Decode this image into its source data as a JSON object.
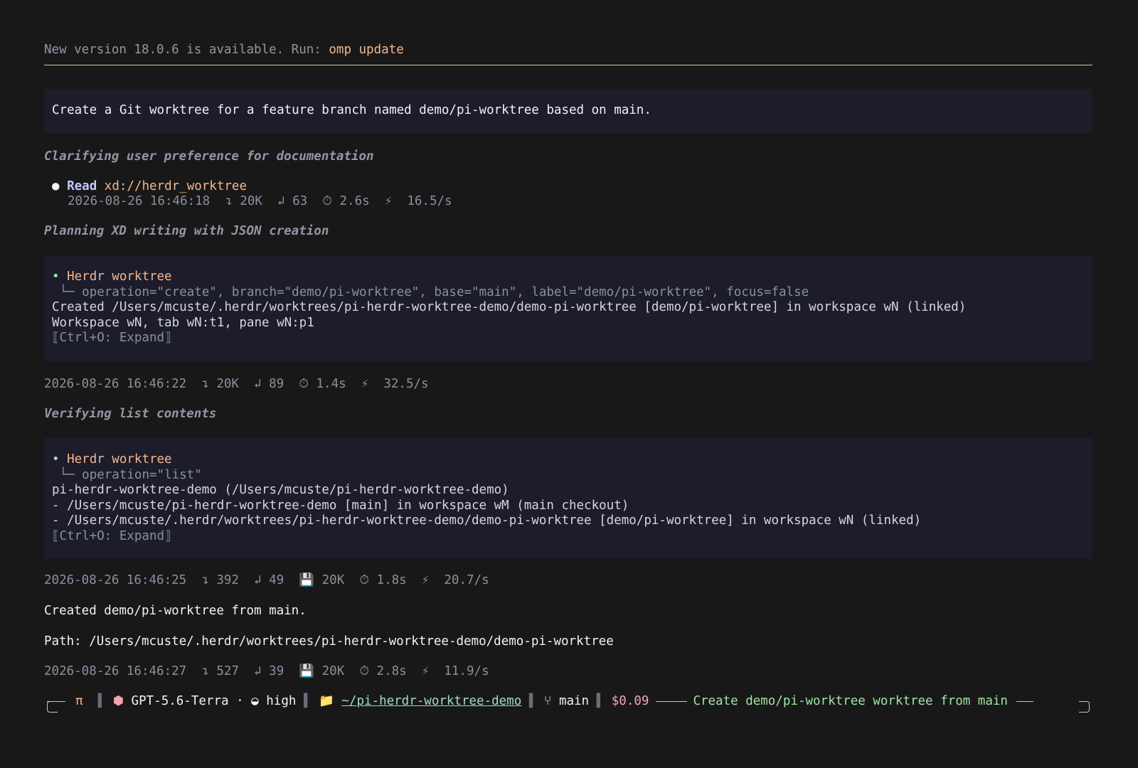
{
  "update": {
    "message": "New version 18.0.6 is available. Run: ",
    "command": "omp update",
    "accent": "#e3c49d"
  },
  "prompt": {
    "text": "Create a Git worktree for a feature branch named demo/pi-worktree based on main."
  },
  "steps": [
    {
      "heading": "Clarifying user preference for documentation"
    },
    {
      "heading": "Planning XD writing with JSON creation"
    },
    {
      "heading": "Verifying list contents"
    }
  ],
  "read_call": {
    "bullet": "●",
    "verb": "Read",
    "target": "xd://herdr_worktree",
    "stats": {
      "time": "2026-08-26 16:46:18",
      "in_icon": "↴",
      "in": "20K",
      "out_icon": "↲",
      "out": "63",
      "dur_icon": "⏱",
      "dur": "2.6s",
      "rate_icon": "⚡",
      "rate": "16.5/s"
    }
  },
  "tool_1": {
    "bullet": "•",
    "title": "Herdr worktree",
    "args_prefix": " └─ ",
    "args": "operation=\"create\", branch=\"demo/pi-worktree\", base=\"main\", label=\"demo/pi-worktree\", focus=false",
    "output": [
      "Created /Users/mcuste/.herdr/worktrees/pi-herdr-worktree-demo/demo-pi-worktree [demo/pi-worktree] in workspace wN (linked)",
      "Workspace wN, tab wN:t1, pane wN:p1"
    ],
    "expand": "⟦Ctrl+O: Expand⟧"
  },
  "stats_2": {
    "time": "2026-08-26 16:46:22",
    "in_icon": "↴",
    "in": "20K",
    "out_icon": "↲",
    "out": "89",
    "dur_icon": "⏱",
    "dur": "1.4s",
    "rate_icon": "⚡",
    "rate": "32.5/s"
  },
  "tool_2": {
    "bullet": "•",
    "title": "Herdr worktree",
    "args_prefix": " └─ ",
    "args": "operation=\"list\"",
    "output": [
      "pi-herdr-worktree-demo (/Users/mcuste/pi-herdr-worktree-demo)",
      "- /Users/mcuste/pi-herdr-worktree-demo [main] in workspace wM (main checkout)",
      "- /Users/mcuste/.herdr/worktrees/pi-herdr-worktree-demo/demo-pi-worktree [demo/pi-worktree] in workspace wN (linked)"
    ],
    "expand": "⟦Ctrl+O: Expand⟧"
  },
  "stats_3": {
    "time": "2026-08-26 16:46:25",
    "in_icon": "↴",
    "in": "392",
    "out_icon": "↲",
    "out": "49",
    "cache_icon": "💾",
    "cache": "20K",
    "dur_icon": "⏱",
    "dur": "1.8s",
    "rate_icon": "⚡",
    "rate": "20.7/s"
  },
  "answer": {
    "line1": "Created demo/pi-worktree from main.",
    "line2": "Path: /Users/mcuste/.herdr/worktrees/pi-herdr-worktree-demo/demo-pi-worktree"
  },
  "stats_4": {
    "time": "2026-08-26 16:46:27",
    "in_icon": "↴",
    "in": "527",
    "out_icon": "↲",
    "out": "39",
    "cache_icon": "💾",
    "cache": "20K",
    "dur_icon": "⏱",
    "dur": "2.8s",
    "rate_icon": "⚡",
    "rate": "11.9/s"
  },
  "status_bar": {
    "pi": "π",
    "sep": "▌",
    "model_icon": "⬢",
    "model": "GPT-5.6-Terra",
    "dot": "·",
    "effort_icon": "◒",
    "effort": "high",
    "folder_icon": "📁",
    "path": "~/pi-herdr-worktree-demo",
    "branch_icon": "⑂",
    "branch": "main",
    "cost": "$0.09",
    "session_title": "Create demo/pi-worktree worktree from main",
    "accent": "#9fe3a0"
  }
}
